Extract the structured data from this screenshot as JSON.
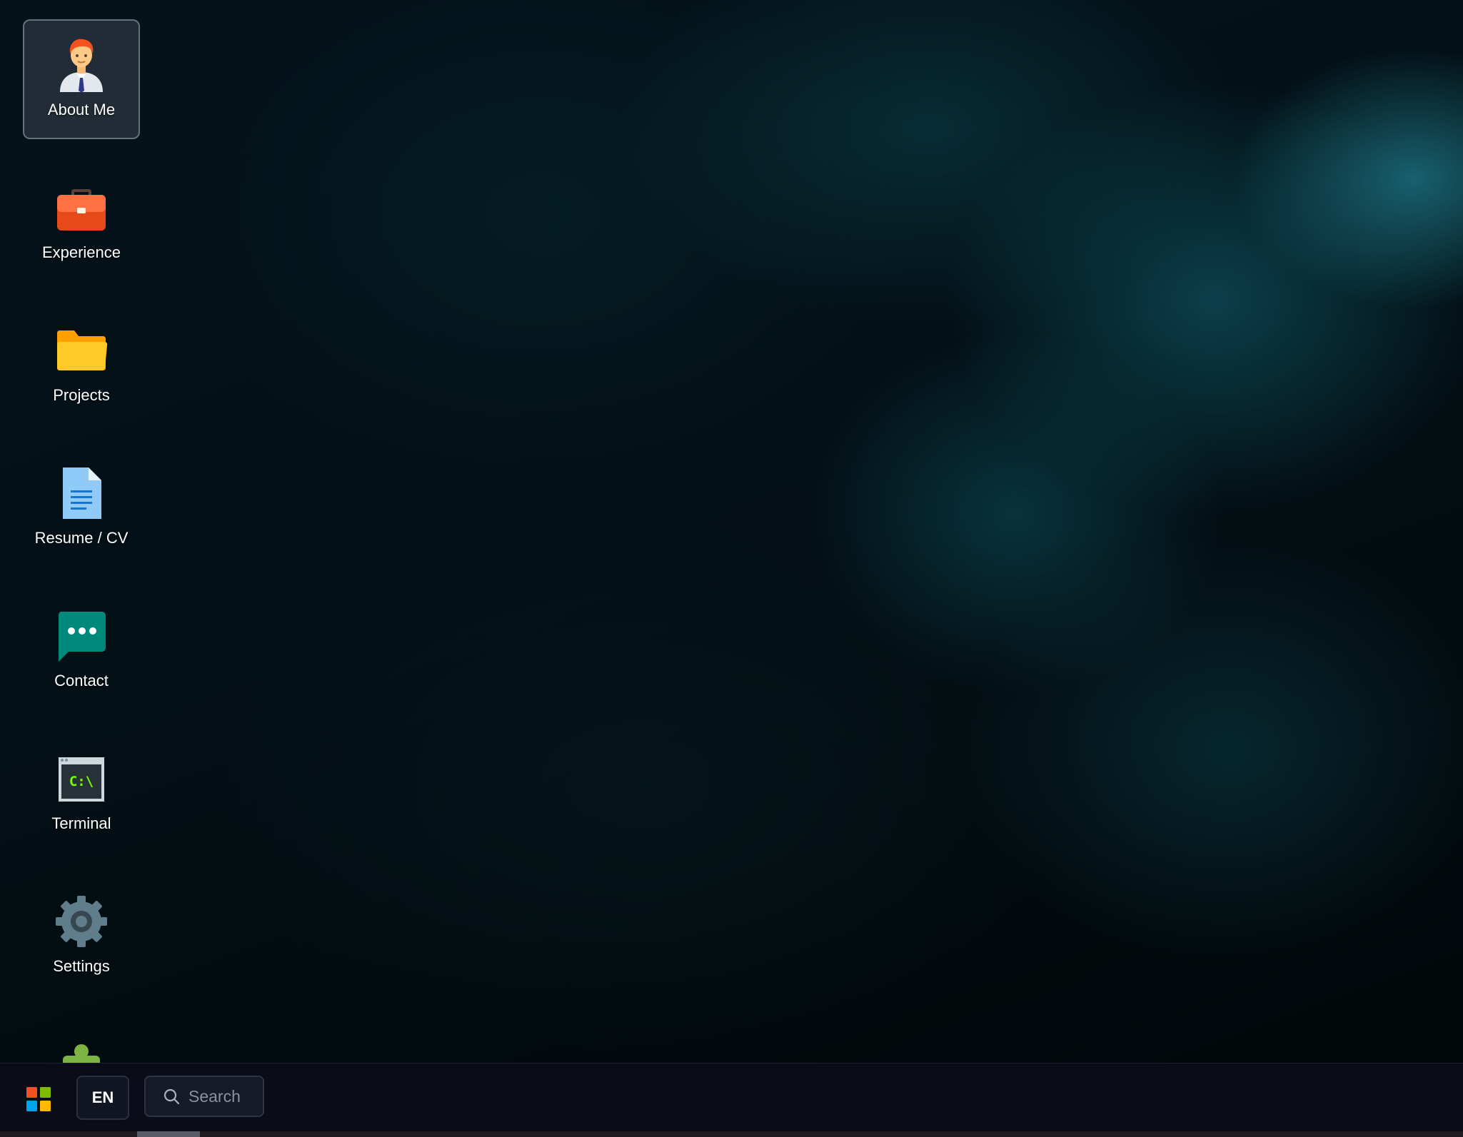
{
  "desktop": {
    "icons": [
      {
        "label": "About Me",
        "icon": "person-icon",
        "selected": true
      },
      {
        "label": "Experience",
        "icon": "briefcase-icon",
        "selected": false
      },
      {
        "label": "Projects",
        "icon": "folder-icon",
        "selected": false
      },
      {
        "label": "Resume / CV",
        "icon": "document-icon",
        "selected": false
      },
      {
        "label": "Contact",
        "icon": "chat-bubble-icon",
        "selected": false
      },
      {
        "label": "Terminal",
        "icon": "terminal-icon",
        "terminal_text": "C:\\",
        "selected": false
      },
      {
        "label": "Settings",
        "icon": "gear-icon",
        "selected": false
      },
      {
        "label": "",
        "icon": "puzzle-piece-icon",
        "selected": false
      }
    ]
  },
  "taskbar": {
    "start_icon": "windows-logo-icon",
    "language": "EN",
    "search": {
      "placeholder": "Search",
      "value": ""
    }
  },
  "colors": {
    "taskbar_bg": "#0a0d17",
    "briefcase": "#f4511e",
    "folder": "#ffb300",
    "document": "#90caf9",
    "chat": "#009688",
    "terminal_text": "#76ff03",
    "gear": "#546e7a",
    "puzzle": "#7cb342"
  }
}
